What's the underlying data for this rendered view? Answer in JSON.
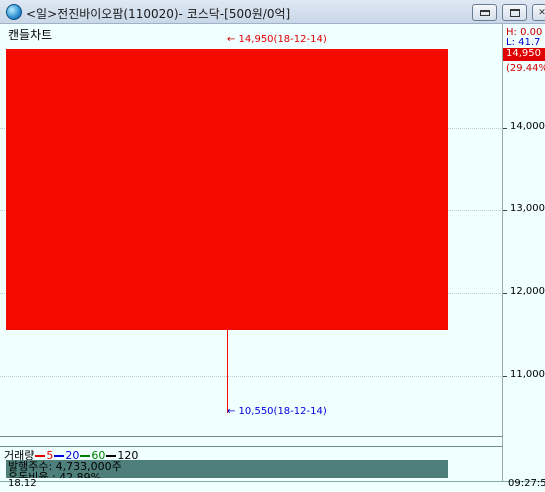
{
  "window": {
    "title": "<일>전진바이오팜(110020)- 코스닥-[500원/0억]"
  },
  "chart": {
    "label": "캔들차트",
    "high_label": "H: 0.00",
    "low_label": "L: 41.7",
    "current_price": "14,950",
    "current_pct": "(29.44%",
    "high_annotation": "← 14,950(18-12-14)",
    "low_annotation": "← 10,550(18-12-14)",
    "y_ticks": [
      "14,000",
      "13,000",
      "12,000",
      "11,000"
    ],
    "colors": {
      "up": "#f50a00",
      "background": "#f0ffff"
    }
  },
  "chart_data": {
    "type": "candlestick",
    "candles": [
      {
        "date": "18-12-14",
        "open": 11550,
        "close": 14950,
        "high": 14950,
        "low": 10550
      }
    ],
    "y_ticks": [
      14000,
      13000,
      12000,
      11000
    ],
    "ylim": [
      10300,
      15250
    ],
    "grid": true
  },
  "volume": {
    "label": "거래량",
    "ma": [
      {
        "label": "5",
        "color": "#e00000"
      },
      {
        "label": "20",
        "color": "#0000e0"
      },
      {
        "label": "60",
        "color": "#008000"
      },
      {
        "label": "120",
        "color": "#000000"
      }
    ]
  },
  "info": {
    "shares": "발행주수: 4,733,000주",
    "float": "유동비율 : 42.89%"
  },
  "status": {
    "date": "18.12",
    "time": "09:27:5"
  }
}
